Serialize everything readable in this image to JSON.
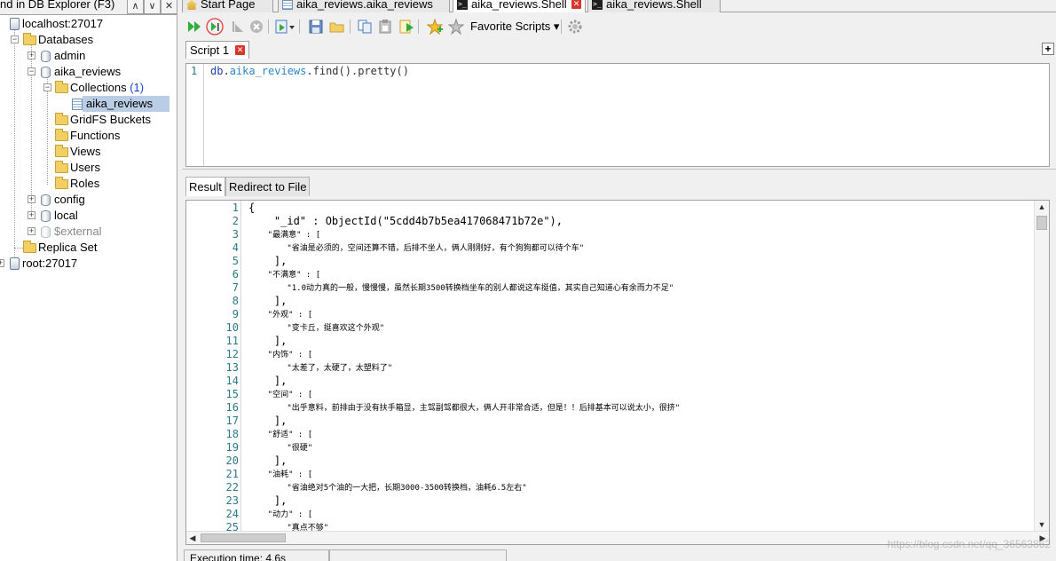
{
  "explorer": {
    "title": "nd in DB Explorer (F3)",
    "header_buttons": [
      "∧",
      "∨",
      "✕"
    ],
    "tree": {
      "server": "localhost:27017",
      "databases": "Databases",
      "admin": "admin",
      "aika_reviews": "aika_reviews",
      "collections": "Collections",
      "collections_count": "(1)",
      "collection_item": "aika_reviews",
      "gridfs": "GridFS Buckets",
      "functions": "Functions",
      "views": "Views",
      "users": "Users",
      "roles": "Roles",
      "config": "config",
      "local": "local",
      "external": "$external",
      "replica_set": "Replica Set",
      "root": "root:27017"
    }
  },
  "tabs": [
    {
      "label": "Start Page",
      "icon": "home-icon"
    },
    {
      "label": "aika_reviews.aika_reviews",
      "icon": "collection-icon"
    },
    {
      "label": "aika_reviews.Shell",
      "icon": "shell-icon",
      "active": true,
      "close": "✕"
    },
    {
      "label": "aika_reviews.Shell",
      "icon": "shell-icon"
    }
  ],
  "toolbar": {
    "favorite_scripts": "Favorite Scripts ▾"
  },
  "script_tab": {
    "label": "Script 1",
    "close": "✕",
    "add": "+"
  },
  "editor": {
    "line_number": "1",
    "db": "db",
    "dot1": ".",
    "collection": "aika_reviews",
    "rest": ".find().pretty()"
  },
  "result_tabs": {
    "result": "Result",
    "redirect": "Redirect to File"
  },
  "result_lines": [
    {
      "n": "1",
      "text": "{"
    },
    {
      "n": "2",
      "text": "    \"_id\" : ObjectId(\"5cdd4b7b5ea417068471b72e\"),"
    },
    {
      "n": "3",
      "text": "    \"最满意\" : ["
    },
    {
      "n": "4",
      "text": "        \"省油是必须的，空间还算不错，后排不坐人，俩人刚刚好，有个狗狗都可以待个车\""
    },
    {
      "n": "5",
      "text": "    ],"
    },
    {
      "n": "6",
      "text": "    \"不满意\" : ["
    },
    {
      "n": "7",
      "text": "        \"1.0动力真的一般，慢慢慢，虽然长期3500转换档坐车的别人都说这车挺值，其实自己知道心有余而力不足\""
    },
    {
      "n": "8",
      "text": "    ],"
    },
    {
      "n": "9",
      "text": "    \"外观\" : ["
    },
    {
      "n": "10",
      "text": "        \"变卡丘，挺喜欢这个外观\""
    },
    {
      "n": "11",
      "text": "    ],"
    },
    {
      "n": "12",
      "text": "    \"内饰\" : ["
    },
    {
      "n": "13",
      "text": "        \"太差了，太硬了，太塑料了\""
    },
    {
      "n": "14",
      "text": "    ],"
    },
    {
      "n": "15",
      "text": "    \"空间\" : ["
    },
    {
      "n": "16",
      "text": "        \"出乎意料，前排由于没有扶手箱显，主驾副驾都很大，俩人开非常合适，但是！！后排基本可以说太小，很挤\""
    },
    {
      "n": "17",
      "text": "    ],"
    },
    {
      "n": "18",
      "text": "    \"舒适\" : ["
    },
    {
      "n": "19",
      "text": "        \"很硬\""
    },
    {
      "n": "20",
      "text": "    ],"
    },
    {
      "n": "21",
      "text": "    \"油耗\" : ["
    },
    {
      "n": "22",
      "text": "        \"省油绝对5个油的一大把，长期3000-3500转换档，油耗6.5左右\""
    },
    {
      "n": "23",
      "text": "    ],"
    },
    {
      "n": "24",
      "text": "    \"动力\" : ["
    },
    {
      "n": "25",
      "text": "        \"真点不够\""
    }
  ],
  "status": {
    "exec_time": "Execution time: 4.6s"
  },
  "watermark": "https://blog.csdn.net/qq_36563862"
}
